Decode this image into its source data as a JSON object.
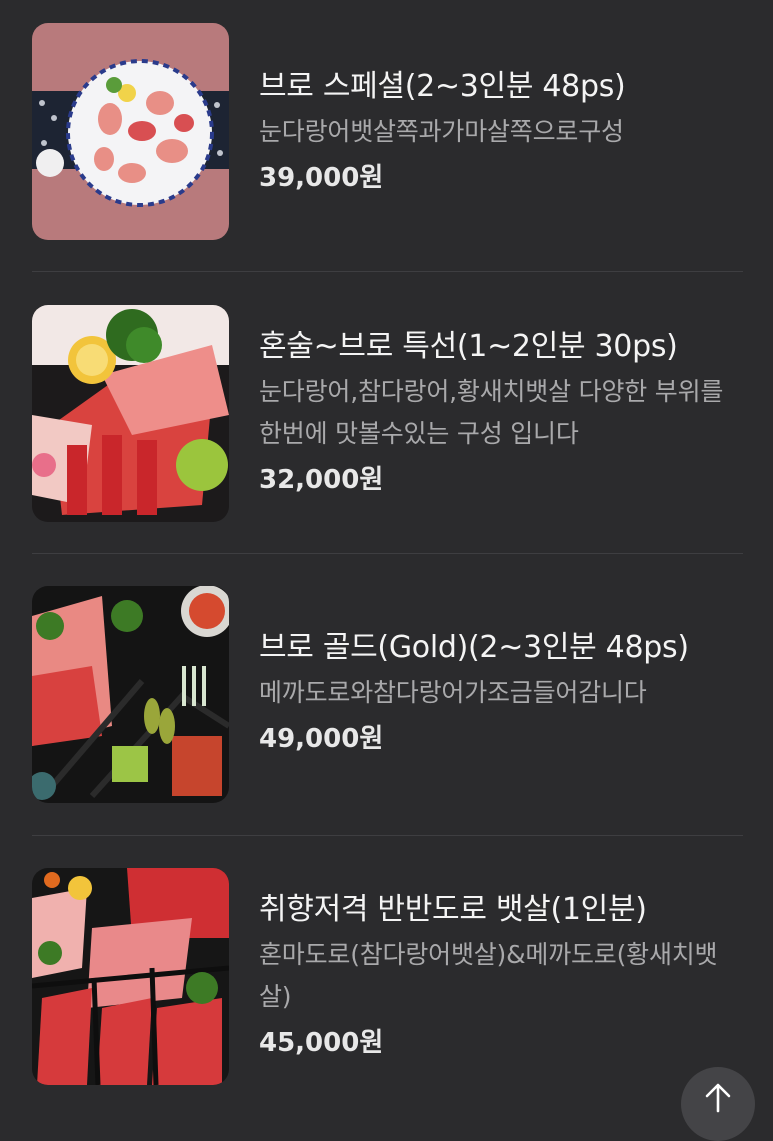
{
  "menu": {
    "items": [
      {
        "name": "브로 스페셜(2~3인분 48ps)",
        "description": "눈다랑어뱃살쪽과가마살쪽으로구성",
        "price": "39,000원",
        "image": "sashimi-platter-photo"
      },
      {
        "name": "혼술~브로 특선(1~2인분 30ps)",
        "description": "눈다랑어,참다랑어,황새치뱃살 다양한 부위를 한번에 맛볼수있는 구성 입니다",
        "price": "32,000원",
        "image": "tuna-sashimi-photo"
      },
      {
        "name": "브로 골드(Gold)(2~3인분 48ps)",
        "description": "메까도로와참다랑어가조금들어감니다",
        "price": "49,000원",
        "image": "tuna-set-photo"
      },
      {
        "name": "취향저격 반반도로 뱃살(1인분)",
        "description": "혼마도로(참다랑어뱃살)&메까도로(황새치뱃살)",
        "price": "45,000원",
        "image": "tuna-belly-photo"
      }
    ]
  },
  "scroll_top_icon": "arrow-up-icon"
}
